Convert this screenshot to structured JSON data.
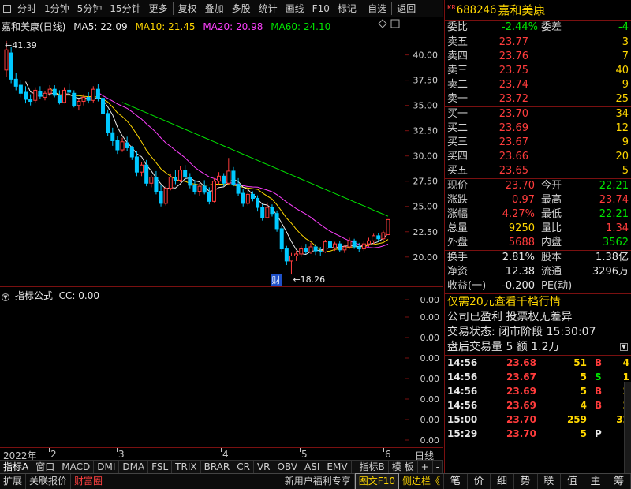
{
  "toolbar": {
    "items": [
      "分时",
      "1分钟",
      "5分钟",
      "15分钟",
      "更多",
      "复权",
      "叠加",
      "多股",
      "统计",
      "画线",
      "F10",
      "标记",
      "-自选",
      "返回"
    ]
  },
  "kline": {
    "title": "嘉和美康(日线)",
    "ma5": "MA5: 22.09",
    "ma10": "MA10: 21.45",
    "ma20": "MA20: 20.98",
    "ma60": "MA60: 24.10",
    "high_label": "41.39",
    "low_label": "18.26",
    "cai_label": "财",
    "price_axis": [
      "40.00",
      "37.50",
      "35.00",
      "32.50",
      "30.00",
      "27.50",
      "25.00",
      "22.50",
      "20.00"
    ],
    "colors": {
      "up": "#ff3c3c",
      "down": "#00c8ff",
      "ma5": "#e8e8e8",
      "ma10": "#ffd700",
      "ma20": "#ff40ff",
      "ma60": "#00e600"
    }
  },
  "sub": {
    "title": "指标公式",
    "cc": "CC: 0.00",
    "axis": [
      "0.00",
      "0.00",
      "0.00",
      "0.00",
      "0.00",
      "0.00",
      "0.00",
      "0.00"
    ]
  },
  "dates": {
    "year": "2022年",
    "months": [
      "2",
      "3",
      "4",
      "5",
      "6"
    ],
    "right_label": "日线"
  },
  "ind_tabs": [
    "指标A",
    "窗口",
    "MACD",
    "DMI",
    "DMA",
    "FSL",
    "TRIX",
    "BRAR",
    "CR",
    "VR",
    "OBV",
    "ASI",
    "EMV",
    "指标B",
    "模 板",
    "+",
    "-"
  ],
  "bottom_bar": {
    "items": [
      "扩展",
      "关联报价",
      "财富圈"
    ],
    "right_items": [
      "新用户福利专享",
      "图文F10",
      "侧边栏《"
    ]
  },
  "quote": {
    "kr": "KR",
    "code": "688246",
    "name": "嘉和美康",
    "webi": {
      "label": "委比",
      "value": "-2.44%",
      "label2": "委差",
      "value2": "-4"
    },
    "asks": [
      {
        "label": "卖五",
        "price": "23.77",
        "vol": "3"
      },
      {
        "label": "卖四",
        "price": "23.76",
        "vol": "7"
      },
      {
        "label": "卖三",
        "price": "23.75",
        "vol": "40"
      },
      {
        "label": "卖二",
        "price": "23.74",
        "vol": "9"
      },
      {
        "label": "卖一",
        "price": "23.72",
        "vol": "25"
      }
    ],
    "bids": [
      {
        "label": "买一",
        "price": "23.70",
        "vol": "34"
      },
      {
        "label": "买二",
        "price": "23.69",
        "vol": "12"
      },
      {
        "label": "买三",
        "price": "23.67",
        "vol": "9"
      },
      {
        "label": "买四",
        "price": "23.66",
        "vol": "20"
      },
      {
        "label": "买五",
        "price": "23.65",
        "vol": "5"
      }
    ],
    "stats1": [
      {
        "l": "现价",
        "v": "23.70",
        "c1": "red",
        "l2": "今开",
        "v2": "22.21",
        "c2": "green"
      },
      {
        "l": "涨跌",
        "v": "0.97",
        "c1": "red",
        "l2": "最高",
        "v2": "23.74",
        "c2": "red"
      },
      {
        "l": "涨幅",
        "v": "4.27%",
        "c1": "red",
        "l2": "最低",
        "v2": "22.21",
        "c2": "green"
      },
      {
        "l": "总量",
        "v": "9250",
        "c1": "yellow",
        "l2": "量比",
        "v2": "1.34",
        "c2": "red"
      },
      {
        "l": "外盘",
        "v": "5688",
        "c1": "red",
        "l2": "内盘",
        "v2": "3562",
        "c2": "green"
      }
    ],
    "stats2": [
      {
        "l": "换手",
        "v": "2.81%",
        "c1": "white",
        "l2": "股本",
        "v2": "1.38亿",
        "c2": "white"
      },
      {
        "l": "净资",
        "v": "12.38",
        "c1": "white",
        "l2": "流通",
        "v2": "3296万",
        "c2": "white"
      },
      {
        "l": "收益(一)",
        "v": "-0.200",
        "c1": "white",
        "l2": "PE(动)",
        "v2": "",
        "c2": "white"
      }
    ],
    "notice": "仅需20元查看千档行情",
    "info1": "公司已盈利 投票权无差异",
    "info2": "交易状态: 闭市阶段 15:30:07",
    "info3": "盘后交易量 5 额 1.2万",
    "ticks": [
      {
        "t": "14:56",
        "p": "23.68",
        "v": "51",
        "bs": "B",
        "c": "red",
        "x": "4"
      },
      {
        "t": "14:56",
        "p": "23.67",
        "v": "5",
        "bs": "S",
        "c": "green",
        "x": "1"
      },
      {
        "t": "14:56",
        "p": "23.69",
        "v": "5",
        "bs": "B",
        "c": "red",
        "x": "2"
      },
      {
        "t": "14:56",
        "p": "23.69",
        "v": "4",
        "bs": "B",
        "c": "red",
        "x": "2"
      },
      {
        "t": "15:00",
        "p": "23.70",
        "v": "259",
        "bs": "",
        "c": "red",
        "x": "32"
      },
      {
        "t": "15:29",
        "p": "23.70",
        "v": "5",
        "bs": "P",
        "c": "white",
        "x": "-"
      }
    ],
    "right_tabs": [
      "笔",
      "价",
      "细",
      "势",
      "联",
      "值",
      "主",
      "筹"
    ]
  },
  "chart_data": {
    "type": "candlestick",
    "title": "嘉和美康(日线)",
    "ylim": [
      18.5,
      42.0
    ],
    "price_ticks": [
      40.0,
      37.5,
      35.0,
      32.5,
      30.0,
      27.5,
      25.0,
      22.5,
      20.0
    ],
    "candles": [
      [
        38.5,
        41.39,
        37.8,
        40.5
      ],
      [
        40.2,
        40.8,
        37.2,
        37.6
      ],
      [
        37.6,
        38.2,
        36.5,
        36.9
      ],
      [
        37.0,
        37.5,
        35.8,
        36.2
      ],
      [
        36.3,
        36.9,
        35.2,
        35.6
      ],
      [
        35.6,
        36.1,
        35.0,
        35.4
      ],
      [
        35.5,
        36.8,
        35.3,
        36.5
      ],
      [
        36.4,
        36.9,
        35.6,
        35.9
      ],
      [
        35.8,
        36.4,
        35.5,
        36.2
      ],
      [
        36.2,
        37.0,
        35.9,
        36.6
      ],
      [
        36.6,
        37.0,
        35.8,
        36.0
      ],
      [
        36.0,
        36.5,
        35.1,
        35.3
      ],
      [
        35.3,
        36.8,
        35.2,
        36.5
      ],
      [
        36.5,
        37.2,
        36.0,
        36.3
      ],
      [
        36.2,
        36.5,
        34.8,
        35.0
      ],
      [
        35.0,
        35.6,
        34.5,
        35.4
      ],
      [
        35.4,
        36.1,
        35.0,
        35.8
      ],
      [
        35.8,
        36.3,
        35.2,
        35.5
      ],
      [
        35.5,
        36.9,
        35.3,
        36.6
      ],
      [
        36.6,
        37.1,
        35.4,
        35.7
      ],
      [
        35.7,
        35.9,
        34.0,
        34.2
      ],
      [
        34.2,
        34.6,
        32.0,
        32.3
      ],
      [
        32.3,
        32.8,
        31.0,
        31.5
      ],
      [
        31.5,
        32.0,
        30.2,
        30.6
      ],
      [
        30.6,
        31.8,
        30.4,
        31.4
      ],
      [
        31.3,
        31.9,
        30.5,
        30.8
      ],
      [
        30.8,
        31.0,
        29.6,
        29.9
      ],
      [
        29.9,
        30.5,
        28.0,
        28.4
      ],
      [
        28.4,
        29.4,
        28.0,
        29.1
      ],
      [
        29.1,
        29.6,
        27.0,
        27.3
      ],
      [
        27.3,
        28.1,
        26.9,
        27.9
      ],
      [
        27.9,
        28.5,
        26.2,
        26.5
      ],
      [
        26.5,
        27.1,
        25.0,
        25.3
      ],
      [
        25.3,
        27.0,
        25.1,
        26.8
      ],
      [
        26.8,
        28.2,
        26.6,
        27.9
      ],
      [
        27.9,
        28.6,
        27.2,
        27.6
      ],
      [
        27.6,
        29.0,
        27.4,
        28.6
      ],
      [
        28.6,
        29.1,
        27.6,
        27.9
      ],
      [
        27.9,
        28.3,
        26.8,
        27.1
      ],
      [
        27.1,
        27.6,
        26.2,
        26.5
      ],
      [
        26.5,
        27.3,
        26.0,
        27.0
      ],
      [
        27.0,
        27.6,
        26.2,
        26.4
      ],
      [
        26.4,
        26.9,
        25.2,
        25.5
      ],
      [
        25.5,
        27.8,
        25.4,
        27.5
      ],
      [
        27.5,
        28.4,
        27.2,
        28.0
      ],
      [
        28.0,
        28.3,
        27.0,
        27.3
      ],
      [
        27.3,
        29.8,
        27.2,
        28.5
      ],
      [
        28.5,
        28.9,
        27.0,
        27.2
      ],
      [
        27.2,
        27.8,
        26.0,
        26.3
      ],
      [
        26.3,
        26.7,
        25.0,
        25.3
      ],
      [
        25.3,
        26.8,
        25.1,
        26.2
      ],
      [
        26.2,
        26.5,
        25.5,
        25.8
      ],
      [
        25.8,
        26.1,
        24.5,
        24.9
      ],
      [
        24.9,
        25.2,
        23.6,
        23.9
      ],
      [
        23.9,
        25.4,
        23.8,
        24.9
      ],
      [
        24.9,
        25.2,
        24.0,
        24.3
      ],
      [
        24.3,
        24.6,
        22.5,
        22.8
      ],
      [
        22.8,
        23.1,
        20.5,
        20.8
      ],
      [
        20.8,
        21.1,
        19.2,
        19.6
      ],
      [
        19.6,
        20.4,
        18.26,
        20.1
      ],
      [
        20.1,
        20.6,
        19.6,
        20.3
      ],
      [
        20.3,
        21.1,
        20.0,
        20.8
      ],
      [
        20.8,
        21.3,
        20.3,
        20.5
      ],
      [
        20.5,
        21.4,
        20.3,
        21.0
      ],
      [
        21.0,
        21.3,
        20.2,
        20.6
      ],
      [
        20.6,
        21.0,
        20.1,
        20.5
      ],
      [
        20.5,
        21.7,
        20.4,
        21.5
      ],
      [
        21.5,
        21.8,
        20.7,
        20.9
      ],
      [
        20.9,
        21.5,
        20.6,
        21.3
      ],
      [
        21.3,
        21.6,
        20.5,
        20.7
      ],
      [
        20.7,
        21.2,
        20.4,
        21.0
      ],
      [
        21.0,
        21.9,
        20.8,
        21.6
      ],
      [
        21.6,
        21.8,
        20.8,
        21.0
      ],
      [
        21.0,
        21.4,
        20.5,
        20.8
      ],
      [
        20.8,
        21.6,
        20.6,
        21.3
      ],
      [
        21.3,
        21.9,
        21.0,
        21.6
      ],
      [
        21.6,
        22.3,
        21.3,
        22.1
      ],
      [
        22.1,
        22.4,
        21.5,
        21.8
      ],
      [
        21.8,
        22.6,
        21.6,
        22.4
      ],
      [
        22.21,
        23.74,
        22.21,
        23.7
      ]
    ]
  }
}
